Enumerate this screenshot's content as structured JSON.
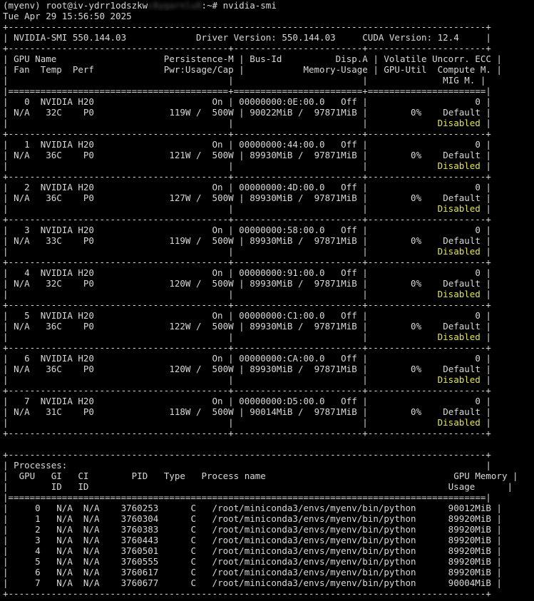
{
  "prompt": {
    "env": "(myenv) ",
    "user_host_visible": "root@iv-ydrr1odszkw",
    "host_blurred": "c8ygarnlu8",
    "path_suffix": ":~# ",
    "command": "nvidia-smi"
  },
  "timestamp": "Tue Apr 29 15:56:50 2025",
  "header": {
    "smi_version": "NVIDIA-SMI 550.144.03",
    "driver_version": "Driver Version: 550.144.03",
    "cuda_version": "CUDA Version: 12.4"
  },
  "columns": {
    "row1": {
      "gpu": "GPU",
      "name": "Name",
      "persistence": "Persistence-M",
      "bus_id": "Bus-Id",
      "disp": "Disp.A",
      "volatile": "Volatile Uncorr. ECC"
    },
    "row2": {
      "fan": "Fan",
      "temp": "Temp",
      "perf": "Perf",
      "pwr": "Pwr:Usage/Cap",
      "memory": "Memory-Usage",
      "util": "GPU-Util",
      "compute": "Compute M."
    },
    "row3": {
      "mig": "MIG M."
    }
  },
  "gpus": [
    {
      "index": "0",
      "name": "NVIDIA H20",
      "persistence": "On",
      "bus_id": "00000000:0E:00.0",
      "disp": "Off",
      "ecc": "0",
      "fan": "N/A",
      "temp": "32C",
      "perf": "P0",
      "pwr_usage": "119W",
      "pwr_cap": "500W",
      "mem_used": "90022MiB",
      "mem_total": "97871MiB",
      "util": "0%",
      "compute": "Default",
      "mig": "Disabled"
    },
    {
      "index": "1",
      "name": "NVIDIA H20",
      "persistence": "On",
      "bus_id": "00000000:44:00.0",
      "disp": "Off",
      "ecc": "0",
      "fan": "N/A",
      "temp": "36C",
      "perf": "P0",
      "pwr_usage": "121W",
      "pwr_cap": "500W",
      "mem_used": "89930MiB",
      "mem_total": "97871MiB",
      "util": "0%",
      "compute": "Default",
      "mig": "Disabled"
    },
    {
      "index": "2",
      "name": "NVIDIA H20",
      "persistence": "On",
      "bus_id": "00000000:4D:00.0",
      "disp": "Off",
      "ecc": "0",
      "fan": "N/A",
      "temp": "36C",
      "perf": "P0",
      "pwr_usage": "127W",
      "pwr_cap": "500W",
      "mem_used": "89930MiB",
      "mem_total": "97871MiB",
      "util": "0%",
      "compute": "Default",
      "mig": "Disabled"
    },
    {
      "index": "3",
      "name": "NVIDIA H20",
      "persistence": "On",
      "bus_id": "00000000:58:00.0",
      "disp": "Off",
      "ecc": "0",
      "fan": "N/A",
      "temp": "33C",
      "perf": "P0",
      "pwr_usage": "119W",
      "pwr_cap": "500W",
      "mem_used": "89930MiB",
      "mem_total": "97871MiB",
      "util": "0%",
      "compute": "Default",
      "mig": "Disabled"
    },
    {
      "index": "4",
      "name": "NVIDIA H20",
      "persistence": "On",
      "bus_id": "00000000:91:00.0",
      "disp": "Off",
      "ecc": "0",
      "fan": "N/A",
      "temp": "32C",
      "perf": "P0",
      "pwr_usage": "120W",
      "pwr_cap": "500W",
      "mem_used": "89930MiB",
      "mem_total": "97871MiB",
      "util": "0%",
      "compute": "Default",
      "mig": "Disabled"
    },
    {
      "index": "5",
      "name": "NVIDIA H20",
      "persistence": "On",
      "bus_id": "00000000:C1:00.0",
      "disp": "Off",
      "ecc": "0",
      "fan": "N/A",
      "temp": "36C",
      "perf": "P0",
      "pwr_usage": "122W",
      "pwr_cap": "500W",
      "mem_used": "89930MiB",
      "mem_total": "97871MiB",
      "util": "0%",
      "compute": "Default",
      "mig": "Disabled"
    },
    {
      "index": "6",
      "name": "NVIDIA H20",
      "persistence": "On",
      "bus_id": "00000000:CA:00.0",
      "disp": "Off",
      "ecc": "0",
      "fan": "N/A",
      "temp": "36C",
      "perf": "P0",
      "pwr_usage": "120W",
      "pwr_cap": "500W",
      "mem_used": "89930MiB",
      "mem_total": "97871MiB",
      "util": "0%",
      "compute": "Default",
      "mig": "Disabled"
    },
    {
      "index": "7",
      "name": "NVIDIA H20",
      "persistence": "On",
      "bus_id": "00000000:D5:00.0",
      "disp": "Off",
      "ecc": "0",
      "fan": "N/A",
      "temp": "31C",
      "perf": "P0",
      "pwr_usage": "118W",
      "pwr_cap": "500W",
      "mem_used": "90014MiB",
      "mem_total": "97871MiB",
      "util": "0%",
      "compute": "Default",
      "mig": "Disabled"
    }
  ],
  "processes_section": {
    "title": "Processes:",
    "headers_row1": {
      "gpu": "GPU",
      "gi": "GI",
      "ci": "CI",
      "pid": "PID",
      "type": "Type",
      "name": "Process name",
      "mem": "GPU Memory"
    },
    "headers_row2": {
      "gi": "ID",
      "ci": "ID",
      "mem": "Usage"
    },
    "rows": [
      {
        "gpu": "0",
        "gi": "N/A",
        "ci": "N/A",
        "pid": "3760253",
        "type": "C",
        "name": "/root/miniconda3/envs/myenv/bin/python",
        "mem": "90012MiB"
      },
      {
        "gpu": "1",
        "gi": "N/A",
        "ci": "N/A",
        "pid": "3760304",
        "type": "C",
        "name": "/root/miniconda3/envs/myenv/bin/python",
        "mem": "89920MiB"
      },
      {
        "gpu": "2",
        "gi": "N/A",
        "ci": "N/A",
        "pid": "3760383",
        "type": "C",
        "name": "/root/miniconda3/envs/myenv/bin/python",
        "mem": "89920MiB"
      },
      {
        "gpu": "3",
        "gi": "N/A",
        "ci": "N/A",
        "pid": "3760443",
        "type": "C",
        "name": "/root/miniconda3/envs/myenv/bin/python",
        "mem": "89920MiB"
      },
      {
        "gpu": "4",
        "gi": "N/A",
        "ci": "N/A",
        "pid": "3760501",
        "type": "C",
        "name": "/root/miniconda3/envs/myenv/bin/python",
        "mem": "89920MiB"
      },
      {
        "gpu": "5",
        "gi": "N/A",
        "ci": "N/A",
        "pid": "3760555",
        "type": "C",
        "name": "/root/miniconda3/envs/myenv/bin/python",
        "mem": "89920MiB"
      },
      {
        "gpu": "6",
        "gi": "N/A",
        "ci": "N/A",
        "pid": "3760617",
        "type": "C",
        "name": "/root/miniconda3/envs/myenv/bin/python",
        "mem": "89920MiB"
      },
      {
        "gpu": "7",
        "gi": "N/A",
        "ci": "N/A",
        "pid": "3760677",
        "type": "C",
        "name": "/root/miniconda3/envs/myenv/bin/python",
        "mem": "90004MiB"
      }
    ]
  },
  "colors": {
    "background": "#000000",
    "text": "#d8d8d8",
    "disabled_highlight": "#e6e64c"
  }
}
